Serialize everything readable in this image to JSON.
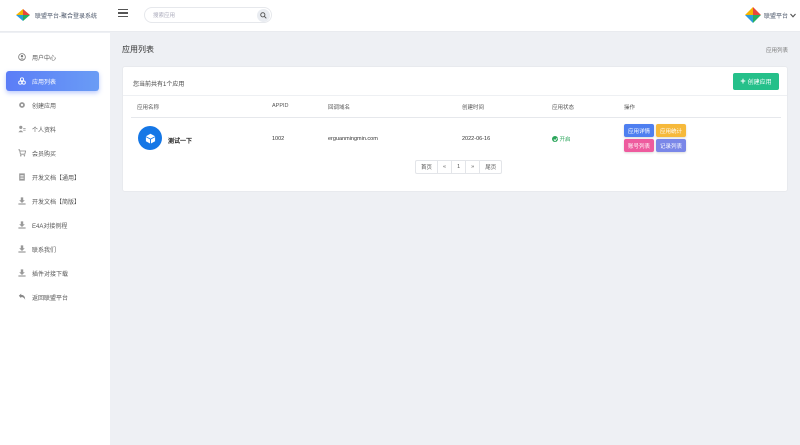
{
  "header": {
    "logo_text": "联盟平台-聚合登录系统",
    "search_placeholder": "搜索应用",
    "user_name": "联盟平台"
  },
  "sidebar": {
    "items": [
      {
        "label": "用户中心",
        "icon": "user-circle-icon",
        "active": false
      },
      {
        "label": "应用列表",
        "icon": "apps-icon",
        "active": true
      },
      {
        "label": "创建应用",
        "icon": "gear-icon",
        "active": false
      },
      {
        "label": "个人资料",
        "icon": "user-card-icon",
        "active": false
      },
      {
        "label": "会员购买",
        "icon": "cart-icon",
        "active": false
      },
      {
        "label": "开发文档【通用】",
        "icon": "doc-icon",
        "active": false
      },
      {
        "label": "开发文档【简版】",
        "icon": "download-icon",
        "active": false
      },
      {
        "label": "E4A对接例程",
        "icon": "download-icon",
        "active": false
      },
      {
        "label": "联系我们",
        "icon": "download-icon",
        "active": false
      },
      {
        "label": "插件对接下载",
        "icon": "download-icon",
        "active": false
      },
      {
        "label": "返回联盟平台",
        "icon": "return-icon",
        "active": false
      }
    ]
  },
  "main": {
    "title": "应用列表",
    "breadcrumb": "应用列表",
    "summary": "您当前共有1个应用",
    "create_label": "创建应用",
    "columns": [
      "应用名称",
      "APPID",
      "回调域名",
      "创建时间",
      "应用状态",
      "操作"
    ],
    "rows": [
      {
        "name": "测试一下",
        "appid": "1002",
        "domain": "erguanmingmin.com",
        "created": "2022-06-16",
        "status": "开启"
      }
    ],
    "actions": [
      "应用详情",
      "应用统计",
      "账号列表",
      "记录列表"
    ],
    "pagination": [
      "首页",
      "«",
      "1",
      "»",
      "尾页"
    ]
  },
  "colors": {
    "accent": "#5b7df7",
    "success": "#25c08a",
    "status_on": "#2aa55a",
    "detail": "#4e7ff0",
    "stats": "#f6b93b",
    "account": "#ee5b9e",
    "record": "#7a87e8"
  }
}
